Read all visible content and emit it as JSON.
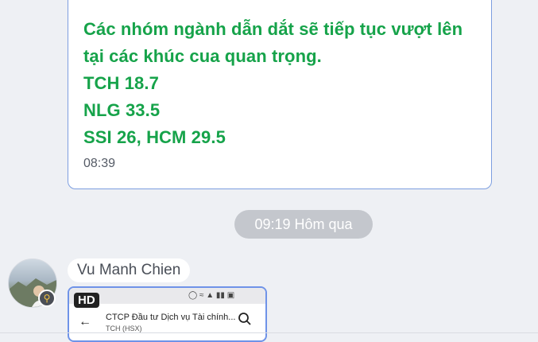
{
  "message": {
    "lines": [
      "Các nhóm ngành dẫn dắt sẽ tiếp tục vượt lên",
      "tại các khúc cua quan trọng.",
      "TCH 18.7",
      "NLG 33.5",
      "SSI 26, HCM 29.5"
    ],
    "time": "08:39"
  },
  "date_separator": "09:19 Hôm qua",
  "next_message": {
    "sender": "Vu Manh Chien",
    "image": {
      "badge": "HD",
      "title": "CTCP Đầu tư Dịch vụ Tài chính...",
      "subtitle": "TCH (HSX)"
    }
  },
  "icons": {
    "avatar_badge": "key-icon",
    "back": "back-arrow-icon",
    "search": "search-icon"
  },
  "colors": {
    "message_text": "#16a34a",
    "bubble_border": "#7d9ee0"
  }
}
